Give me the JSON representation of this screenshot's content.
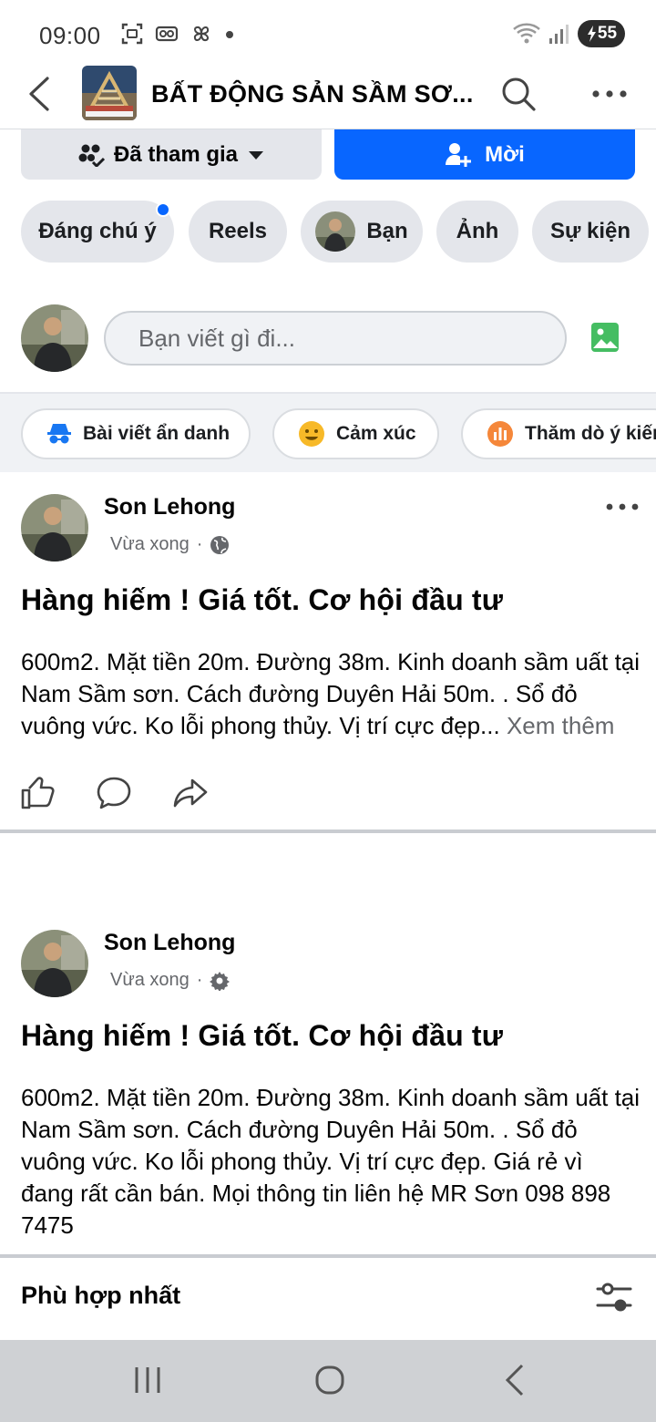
{
  "status_bar": {
    "time": "09:00",
    "battery": "55"
  },
  "header": {
    "group_title": "BẤT ĐỘNG SẢN SẦM SƠ..."
  },
  "actions": {
    "joined_label": "Đã tham gia",
    "invite_label": "Mời"
  },
  "chips": [
    "Đáng chú ý",
    "Reels",
    "Bạn",
    "Ảnh",
    "Sự kiện"
  ],
  "composer": {
    "placeholder": "Bạn viết gì đi..."
  },
  "quick_actions": [
    "Bài viết ẩn danh",
    "Cảm xúc",
    "Thăm dò ý kiến"
  ],
  "posts": [
    {
      "author": "Son Lehong",
      "time": "Vừa xong",
      "title": "Hàng hiếm ! Giá tốt. Cơ hội đầu tư",
      "body": "600m2. Mặt tiền 20m. Đường 38m. Kinh doanh sầm uất tại Nam Sầm sơn. Cách đường Duyên Hải 50m. . Sổ đỏ vuông vức. Ko lỗi phong thủy. Vị trí cực đẹp...",
      "see_more": "Xem thêm"
    },
    {
      "author": "Son Lehong",
      "time": "Vừa xong",
      "title": "Hàng hiếm ! Giá tốt. Cơ hội đầu tư",
      "body": "600m2. Mặt tiền 20m. Đường 38m. Kinh doanh sầm uất tại Nam Sầm sơn. Cách đường Duyên Hải 50m. . Sổ đỏ vuông vức. Ko lỗi phong thủy. Vị trí cực đẹp. Giá rẻ vì đang rất cần bán. Mọi thông tin liên hệ  MR Sơn 098 898 7475"
    }
  ],
  "sort": {
    "label": "Phù hợp nhất"
  },
  "colors": {
    "accent": "#0866ff",
    "chip_bg": "#e4e6eb",
    "secondary_text": "#65676b"
  }
}
